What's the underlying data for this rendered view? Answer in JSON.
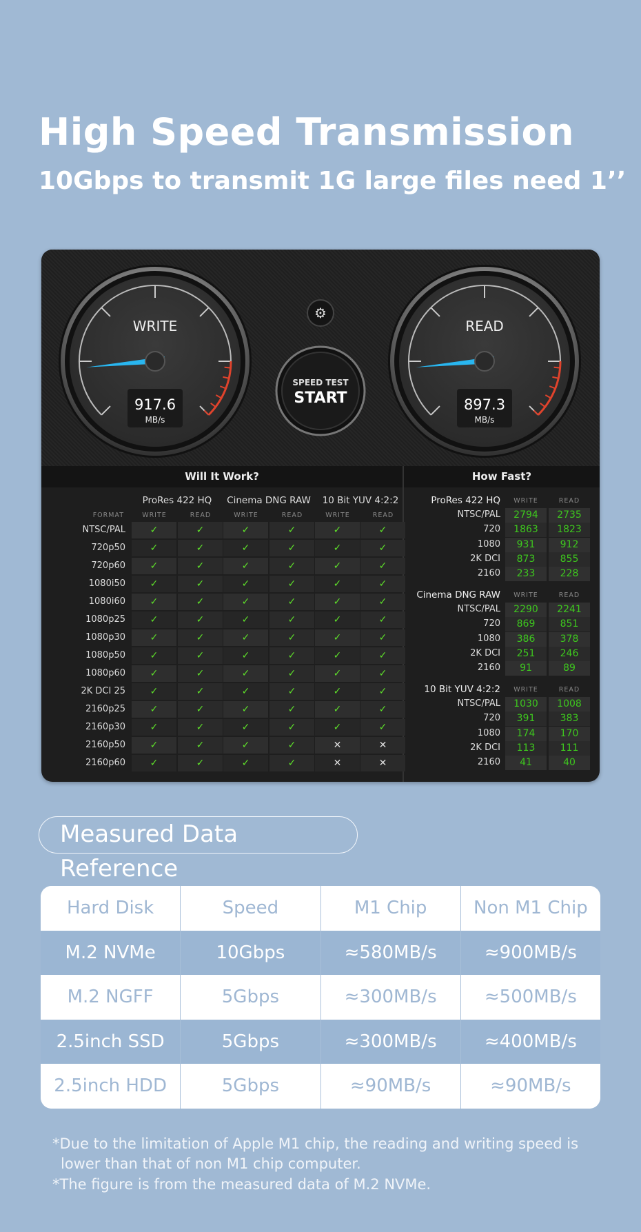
{
  "header": {
    "title": "High Speed Transmission",
    "subtitle": "10Gbps to transmit 1G large files need 1’’"
  },
  "speedtest": {
    "write_gauge": {
      "label": "WRITE",
      "value": "917.6",
      "unit": "MB/s"
    },
    "read_gauge": {
      "label": "READ",
      "value": "897.3",
      "unit": "MB/s"
    },
    "start_button": {
      "line1": "SPEED TEST",
      "line2": "START"
    },
    "settings_icon": "gear-icon",
    "colors": {
      "needle": "#29b6f0",
      "redline": "#e0432c",
      "value_green": "#3ec81e"
    },
    "will_it_work": {
      "title": "Will It Work?",
      "format_label": "FORMAT",
      "codecs": [
        "ProRes 422 HQ",
        "Cinema DNG RAW",
        "10 Bit YUV 4:2:2"
      ],
      "subcols": [
        "WRITE",
        "READ"
      ],
      "rows": [
        {
          "format": "NTSC/PAL",
          "ok": [
            1,
            1,
            1,
            1,
            1,
            1
          ]
        },
        {
          "format": "720p50",
          "ok": [
            1,
            1,
            1,
            1,
            1,
            1
          ]
        },
        {
          "format": "720p60",
          "ok": [
            1,
            1,
            1,
            1,
            1,
            1
          ]
        },
        {
          "format": "1080i50",
          "ok": [
            1,
            1,
            1,
            1,
            1,
            1
          ]
        },
        {
          "format": "1080i60",
          "ok": [
            1,
            1,
            1,
            1,
            1,
            1
          ]
        },
        {
          "format": "1080p25",
          "ok": [
            1,
            1,
            1,
            1,
            1,
            1
          ]
        },
        {
          "format": "1080p30",
          "ok": [
            1,
            1,
            1,
            1,
            1,
            1
          ]
        },
        {
          "format": "1080p50",
          "ok": [
            1,
            1,
            1,
            1,
            1,
            1
          ]
        },
        {
          "format": "1080p60",
          "ok": [
            1,
            1,
            1,
            1,
            1,
            1
          ]
        },
        {
          "format": "2K DCI 25",
          "ok": [
            1,
            1,
            1,
            1,
            1,
            1
          ]
        },
        {
          "format": "2160p25",
          "ok": [
            1,
            1,
            1,
            1,
            1,
            1
          ]
        },
        {
          "format": "2160p30",
          "ok": [
            1,
            1,
            1,
            1,
            1,
            1
          ]
        },
        {
          "format": "2160p50",
          "ok": [
            1,
            1,
            1,
            1,
            0,
            0
          ]
        },
        {
          "format": "2160p60",
          "ok": [
            1,
            1,
            1,
            1,
            0,
            0
          ]
        }
      ],
      "check": "✓",
      "cross": "✕"
    },
    "how_fast": {
      "title": "How Fast?",
      "groups": [
        {
          "codec": "ProRes 422 HQ",
          "write": "WRITE",
          "read": "READ",
          "rows": [
            [
              "NTSC/PAL",
              "2794",
              "2735"
            ],
            [
              "720",
              "1863",
              "1823"
            ],
            [
              "1080",
              "931",
              "912"
            ],
            [
              "2K DCI",
              "873",
              "855"
            ],
            [
              "2160",
              "233",
              "228"
            ]
          ]
        },
        {
          "codec": "Cinema DNG RAW",
          "write": "WRITE",
          "read": "READ",
          "rows": [
            [
              "NTSC/PAL",
              "2290",
              "2241"
            ],
            [
              "720",
              "869",
              "851"
            ],
            [
              "1080",
              "386",
              "378"
            ],
            [
              "2K DCI",
              "251",
              "246"
            ],
            [
              "2160",
              "91",
              "89"
            ]
          ]
        },
        {
          "codec": "10 Bit YUV 4:2:2",
          "write": "WRITE",
          "read": "READ",
          "rows": [
            [
              "NTSC/PAL",
              "1030",
              "1008"
            ],
            [
              "720",
              "391",
              "383"
            ],
            [
              "1080",
              "174",
              "170"
            ],
            [
              "2K DCI",
              "113",
              "111"
            ],
            [
              "2160",
              "41",
              "40"
            ]
          ]
        }
      ]
    }
  },
  "reference": {
    "title": "Measured Data Reference",
    "columns": [
      "Hard Disk",
      "Speed",
      "M1 Chip",
      "Non M1 Chip"
    ],
    "rows": [
      [
        "M.2 NVMe",
        "10Gbps",
        "≈580MB/s",
        "≈900MB/s"
      ],
      [
        "M.2 NGFF",
        "5Gbps",
        "≈300MB/s",
        "≈500MB/s"
      ],
      [
        "2.5inch SSD",
        "5Gbps",
        "≈300MB/s",
        "≈400MB/s"
      ],
      [
        "2.5inch HDD",
        "5Gbps",
        "≈90MB/s",
        "≈90MB/s"
      ]
    ]
  },
  "notes": [
    "*Due to the limitation of Apple M1 chip, the reading and writing speed is",
    "lower than that of non M1 chip computer.",
    "*The figure is from the measured data of M.2 NVMe."
  ]
}
